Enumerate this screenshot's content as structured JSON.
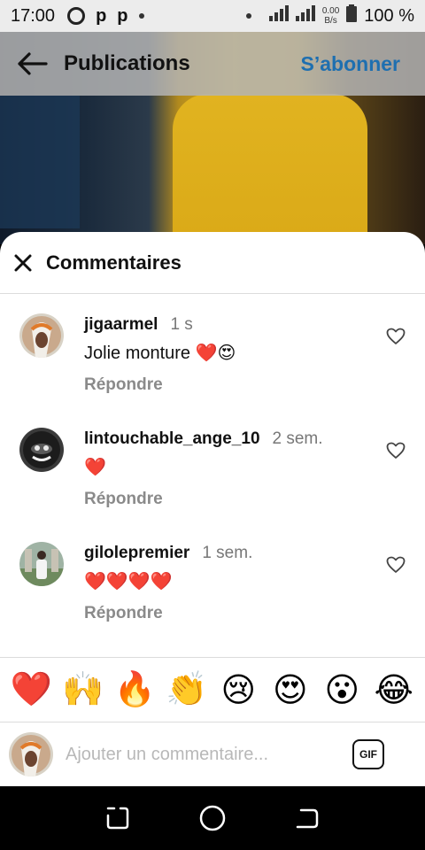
{
  "status_bar": {
    "time": "17:00",
    "icons": [
      "privacy-circle-icon",
      "p-app-icon",
      "p-app-icon",
      "dot-icon"
    ],
    "speed_value": "0.00",
    "speed_unit": "B/s",
    "battery": "100 %"
  },
  "header": {
    "title": "Publications",
    "subscribe_label": "S’abonner",
    "accent_color": "#1e6fb0"
  },
  "sheet": {
    "title": "Commentaires"
  },
  "comments": [
    {
      "username": "jigaarmel",
      "time": "1 s",
      "text": "Jolie monture ❤️😍",
      "reply_label": "Répondre"
    },
    {
      "username": "lintouchable_ange_10",
      "time": "2 sem.",
      "text": "❤️",
      "reply_label": "Répondre"
    },
    {
      "username": "gilolepremier",
      "time": "1 sem.",
      "text": "❤️❤️❤️❤️",
      "reply_label": "Répondre"
    }
  ],
  "emoji_bar": [
    "❤️",
    "🙌",
    "🔥",
    "👏",
    "😢",
    "😍",
    "😮",
    "😂"
  ],
  "composer": {
    "placeholder": "Ajouter un commentaire...",
    "gif_label": "GIF"
  }
}
